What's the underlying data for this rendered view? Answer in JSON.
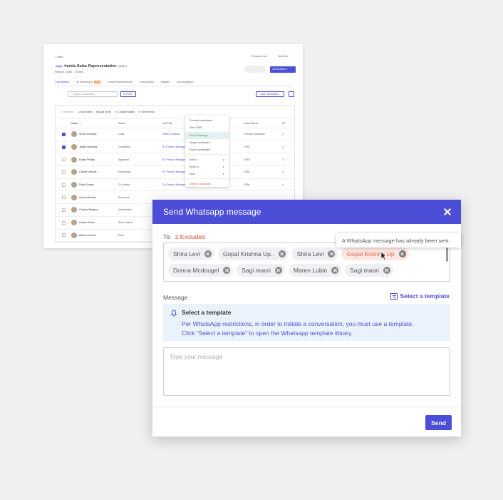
{
  "background": {
    "breadcrumb": "Jobs",
    "prev_job": "Previous Job",
    "next_job": "Next Job",
    "job_status_tag": "Open",
    "job_title": "Inside Sales Representative",
    "job_id": "| 250842",
    "job_location": "Rehovot, Israel",
    "job_roles": "2 Roles",
    "job_actions": "Job Actions",
    "tabs": [
      {
        "label": "Candidates",
        "count": ""
      },
      {
        "label": "AI Discovery",
        "count": "100"
      },
      {
        "label": "Video Assessments",
        "count": ""
      },
      {
        "label": "Description",
        "count": ""
      },
      {
        "label": "Details",
        "count": ""
      },
      {
        "label": "Job Analytics",
        "count": ""
      }
    ],
    "search_placeholder": "Search candidates",
    "filter_label": "Filter",
    "add_candidates_label": "Add Candidates",
    "kebab": "⋮",
    "toolbar": {
      "selected": "1 Selected",
      "add_notes": "Add notes",
      "add_to_list": "Add to list",
      "change_status": "Change status",
      "send_email": "Send email",
      "more": "⋮"
    },
    "columns": [
      "Name",
      "Status",
      "Job Title",
      "",
      "Lead Source",
      "Fit"
    ],
    "rows": [
      {
        "name": "Shira Gonzalez",
        "status": "Lead",
        "job": "Writer, Libraries",
        "rel": "",
        "lead": "Chrome Extension",
        "fit": "A",
        "checked": true
      },
      {
        "name": "Jaylen Mezzara",
        "status": "Contacted",
        "job": "Sr. Product Managers",
        "rel": "",
        "lead": "CRM",
        "fit": "A",
        "checked": true
      },
      {
        "name": "Roger Phillips",
        "status": "Applicant",
        "job": "Sr. Product Managers",
        "rel": "",
        "lead": "CRM",
        "fit": "A",
        "checked": false
      },
      {
        "name": "Charlie Vetrovs",
        "status": "Expository",
        "job": "Sr. Product Managers",
        "rel": "",
        "lead": "CRM",
        "fit": "A",
        "checked": false
      },
      {
        "name": "Davis Dorwin",
        "status": "To Screen",
        "job": "Sr. Product Managers",
        "rel": "Any!",
        "lead": "CRM",
        "fit": "A",
        "checked": false
      },
      {
        "name": "Hanna Botman",
        "status": "Screened",
        "job": "",
        "rel": "",
        "lead": "",
        "fit": "",
        "checked": false
      },
      {
        "name": "Chance Bergson",
        "status": "Interviewed",
        "job": "",
        "rel": "",
        "lead": "",
        "fit": "",
        "checked": false
      },
      {
        "name": "Ruben Center",
        "status": "Short Listed",
        "job": "",
        "rel": "",
        "lead": "",
        "fit": "",
        "checked": false
      },
      {
        "name": "Alfonso Kenter",
        "status": "Pass",
        "job": "",
        "rel": "",
        "lead": "",
        "fit": "",
        "checked": false
      }
    ],
    "menu_items": [
      {
        "label": "Forward candidates",
        "arrow": "",
        "style": ""
      },
      {
        "label": "Send SMS",
        "arrow": "",
        "style": ""
      },
      {
        "label": "Send Whatsapp",
        "arrow": "",
        "style": "hl"
      },
      {
        "label": "Merge candidates",
        "arrow": "",
        "style": ""
      },
      {
        "label": "Export candidates",
        "arrow": "",
        "style": ""
      },
      {
        "label": "Add to",
        "arrow": "▸",
        "style": ""
      },
      {
        "label": "Invite to",
        "arrow": "▸",
        "style": ""
      },
      {
        "label": "More",
        "arrow": "▸",
        "style": ""
      },
      {
        "label": "Delete Candidates",
        "arrow": "",
        "style": "danger"
      }
    ]
  },
  "modal": {
    "title": "Send Whatsapp message",
    "to_label": "To:",
    "excluded_label": "2 Excluded",
    "tooltip": "A WhatsApp message has already been sent",
    "recipients": [
      {
        "name": "Shira Levi",
        "excluded": false
      },
      {
        "name": "Gopal Krishna Up..",
        "excluded": false
      },
      {
        "name": "Shira Levi",
        "excluded": false
      },
      {
        "name": "Gopal Krishna Up",
        "excluded": true
      },
      {
        "name": "Donna Mcdougel",
        "excluded": false
      },
      {
        "name": "Sagi maori",
        "excluded": false
      },
      {
        "name": "Maren Lubin",
        "excluded": false
      },
      {
        "name": "Sagi maori",
        "excluded": false
      }
    ],
    "message_label": "Message",
    "select_template_label": "Select a template",
    "info_title": "Select a template",
    "info_line1": "Per WhatsApp restrictions, in order to initiate a conversation, you must use a template.",
    "info_line2": "Click “Select a template” to open the Whatsapp template library.",
    "message_placeholder": "Type your message",
    "send_label": "Send"
  },
  "colors": {
    "primary": "#4d4ed8",
    "excluded": "#e8604c",
    "info_bg": "#eaf3fb"
  }
}
